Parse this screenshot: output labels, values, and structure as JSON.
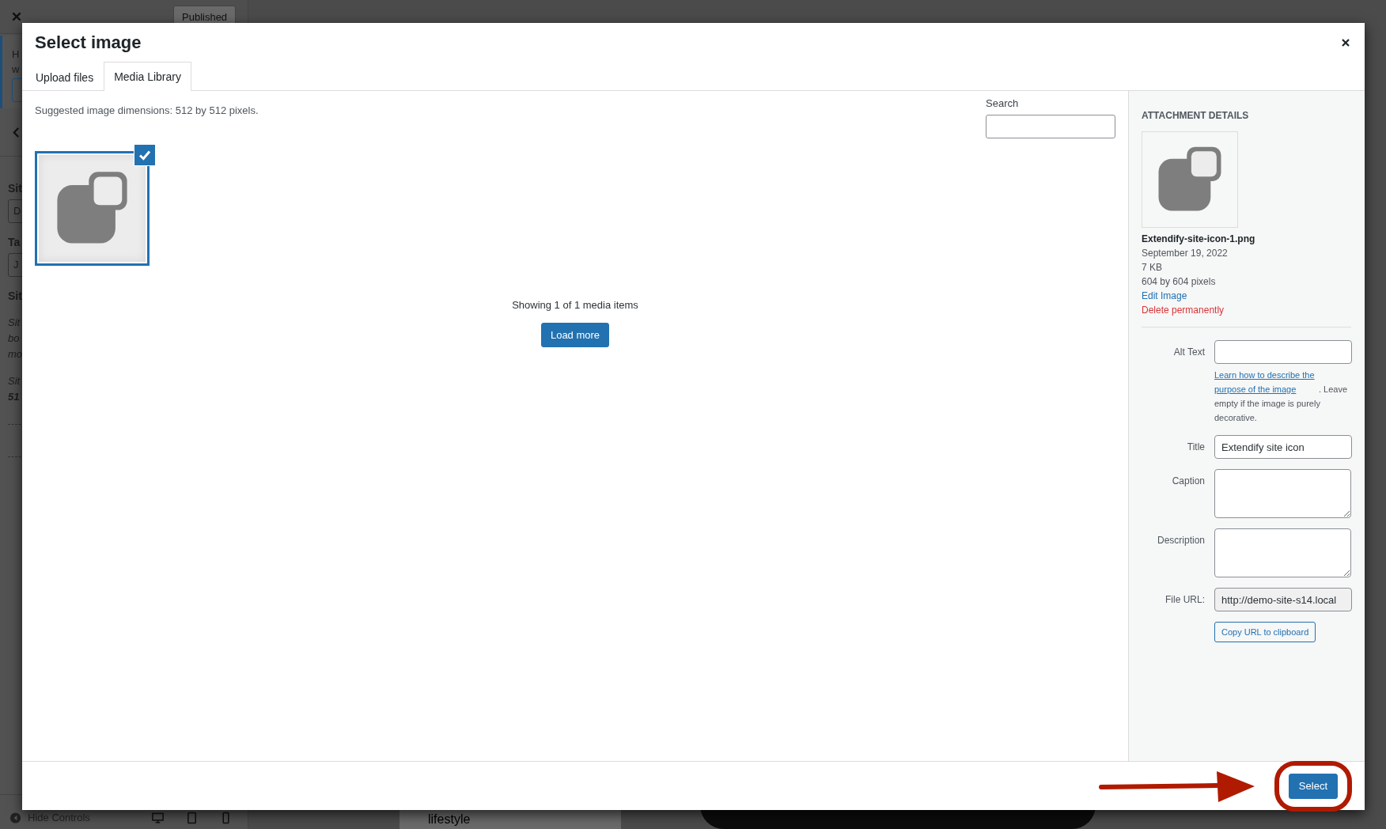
{
  "backdrop": {
    "publish_button": "Published",
    "notice_fragments": [
      "H",
      "w"
    ],
    "left_fragments": [
      {
        "kind": "heading",
        "text": "Sit"
      },
      {
        "kind": "field",
        "text": "D"
      },
      {
        "kind": "heading",
        "text": "Ta"
      },
      {
        "kind": "field",
        "text": "J"
      },
      {
        "kind": "heading",
        "text": "Sit"
      },
      {
        "kind": "italic",
        "text": "Sit"
      },
      {
        "kind": "italic",
        "text": "bo"
      },
      {
        "kind": "italic",
        "text": "mo"
      },
      {
        "kind": "italic",
        "text": "Sit"
      },
      {
        "kind": "bolditalic",
        "text": "51"
      }
    ],
    "hide_controls": "Hide Controls",
    "preview_text": "lifestyle"
  },
  "modal": {
    "title": "Select image",
    "tabs": [
      {
        "label": "Upload files",
        "selected": false
      },
      {
        "label": "Media Library",
        "selected": true
      }
    ],
    "hint": "Suggested image dimensions: 512 by 512 pixels.",
    "search": {
      "label": "Search"
    },
    "items": [
      {
        "selected": true
      }
    ],
    "count": "Showing 1 of 1 media items",
    "load_more": "Load more"
  },
  "details": {
    "heading": "ATTACHMENT DETAILS",
    "filename": "Extendify-site-icon-1.png",
    "date": "September 19, 2022",
    "size": "7 KB",
    "dimensions": "604 by 604 pixels",
    "edit_link": "Edit Image",
    "delete_link": "Delete permanently",
    "fields": [
      {
        "kind": "input",
        "label": "Alt Text"
      },
      {
        "kind": "help",
        "link": "Learn how to describe the purpose of the image",
        "text": ". Leave empty if the image is purely decorative."
      },
      {
        "kind": "input",
        "label": "Title",
        "value": "Extendify site icon"
      },
      {
        "kind": "textarea",
        "label": "Caption"
      },
      {
        "kind": "textarea",
        "label": "Description"
      },
      {
        "kind": "readonly",
        "label": "File URL:",
        "value": "http://demo-site-s14.local"
      }
    ],
    "copy_button": "Copy URL to clipboard"
  },
  "footer": {
    "select_button": "Select"
  }
}
